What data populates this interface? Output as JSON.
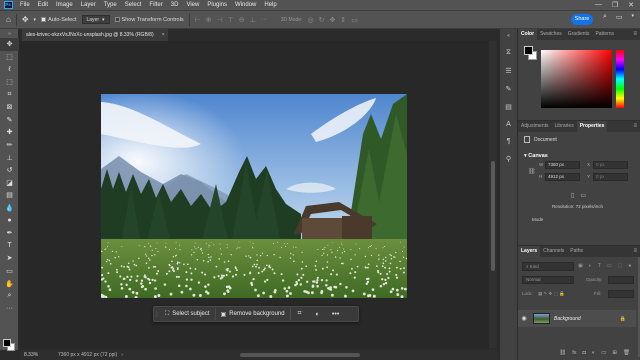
{
  "menubar": {
    "logo": "Ps",
    "items": [
      "File",
      "Edit",
      "Image",
      "Layer",
      "Type",
      "Select",
      "Filter",
      "3D",
      "View",
      "Plugins",
      "Window",
      "Help"
    ],
    "controls": [
      "—",
      "❐",
      "✕"
    ]
  },
  "options": {
    "auto_select_label": "Auto-Select",
    "layer_select": "Layer",
    "transform_label": "Show Transform Controls",
    "mode_3d_label": "3D Mode:",
    "share_label": "Share"
  },
  "document": {
    "tab_title": "ales-krivec-okzxVsJNxXc-unsplash.jpg @ 8.33% (RGB/8)",
    "zoom": "8.33%",
    "dims": "7360 px x 4912 px (72 ppi)"
  },
  "taskbar": {
    "select_subject": "Select subject",
    "remove_background": "Remove background",
    "more": "•••"
  },
  "panels": {
    "color_tabs": [
      "Color",
      "Swatches",
      "Gradients",
      "Patterns"
    ],
    "prop_tabs": [
      "Adjustments",
      "Libraries",
      "Properties"
    ],
    "document_label": "Document",
    "canvas_label": "Canvas",
    "w_label": "W",
    "w_value": "7360 px",
    "h_label": "H",
    "h_value": "4912 px",
    "x_label": "X",
    "x_value": "0 px",
    "y_label": "Y",
    "y_value": "0 px",
    "resolution": "Resolution: 72 pixels/inch",
    "mode": "Mode",
    "layer_tabs": [
      "Layers",
      "Channels",
      "Paths"
    ],
    "kind_placeholder": "Kind",
    "blend_mode": "Normal",
    "opacity_label": "Opacity:",
    "lock_label": "Lock:",
    "fill_label": "Fill:",
    "layer_name": "Background"
  },
  "colors": {
    "accent": "#1473e6",
    "foreground": "#000000",
    "background": "#ffffff"
  }
}
